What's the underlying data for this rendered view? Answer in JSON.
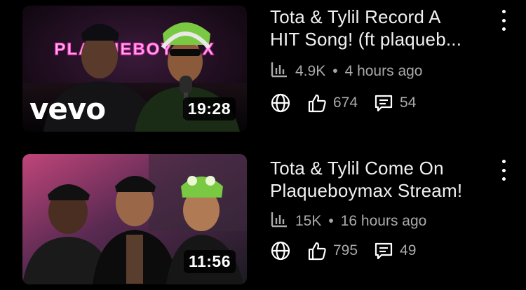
{
  "videos": [
    {
      "title_line1": "Tota & Tylil Record A",
      "title_line2": "HIT Song! (ft plaqueb...",
      "duration": "19:28",
      "views": "4.9K",
      "separator": "•",
      "age": "4 hours ago",
      "likes": "674",
      "comments": "54",
      "thumb_text": "PLAQUEBOYMAX",
      "badge": "vevo"
    },
    {
      "title_line1": "Tota & Tylil Come On",
      "title_line2": "Plaqueboymax Stream!",
      "duration": "11:56",
      "views": "15K",
      "separator": "•",
      "age": "16 hours ago",
      "likes": "795",
      "comments": "49"
    }
  ],
  "icons": {
    "stats": "bar-chart-icon",
    "globe": "globe-icon",
    "like": "thumbs-up-icon",
    "comment": "comment-icon",
    "menu": "more-vertical-icon"
  },
  "colors": {
    "background": "#000000",
    "title": "#f1f1f1",
    "meta": "#aaaaaa",
    "neon_pink": "#ff3cc7"
  }
}
